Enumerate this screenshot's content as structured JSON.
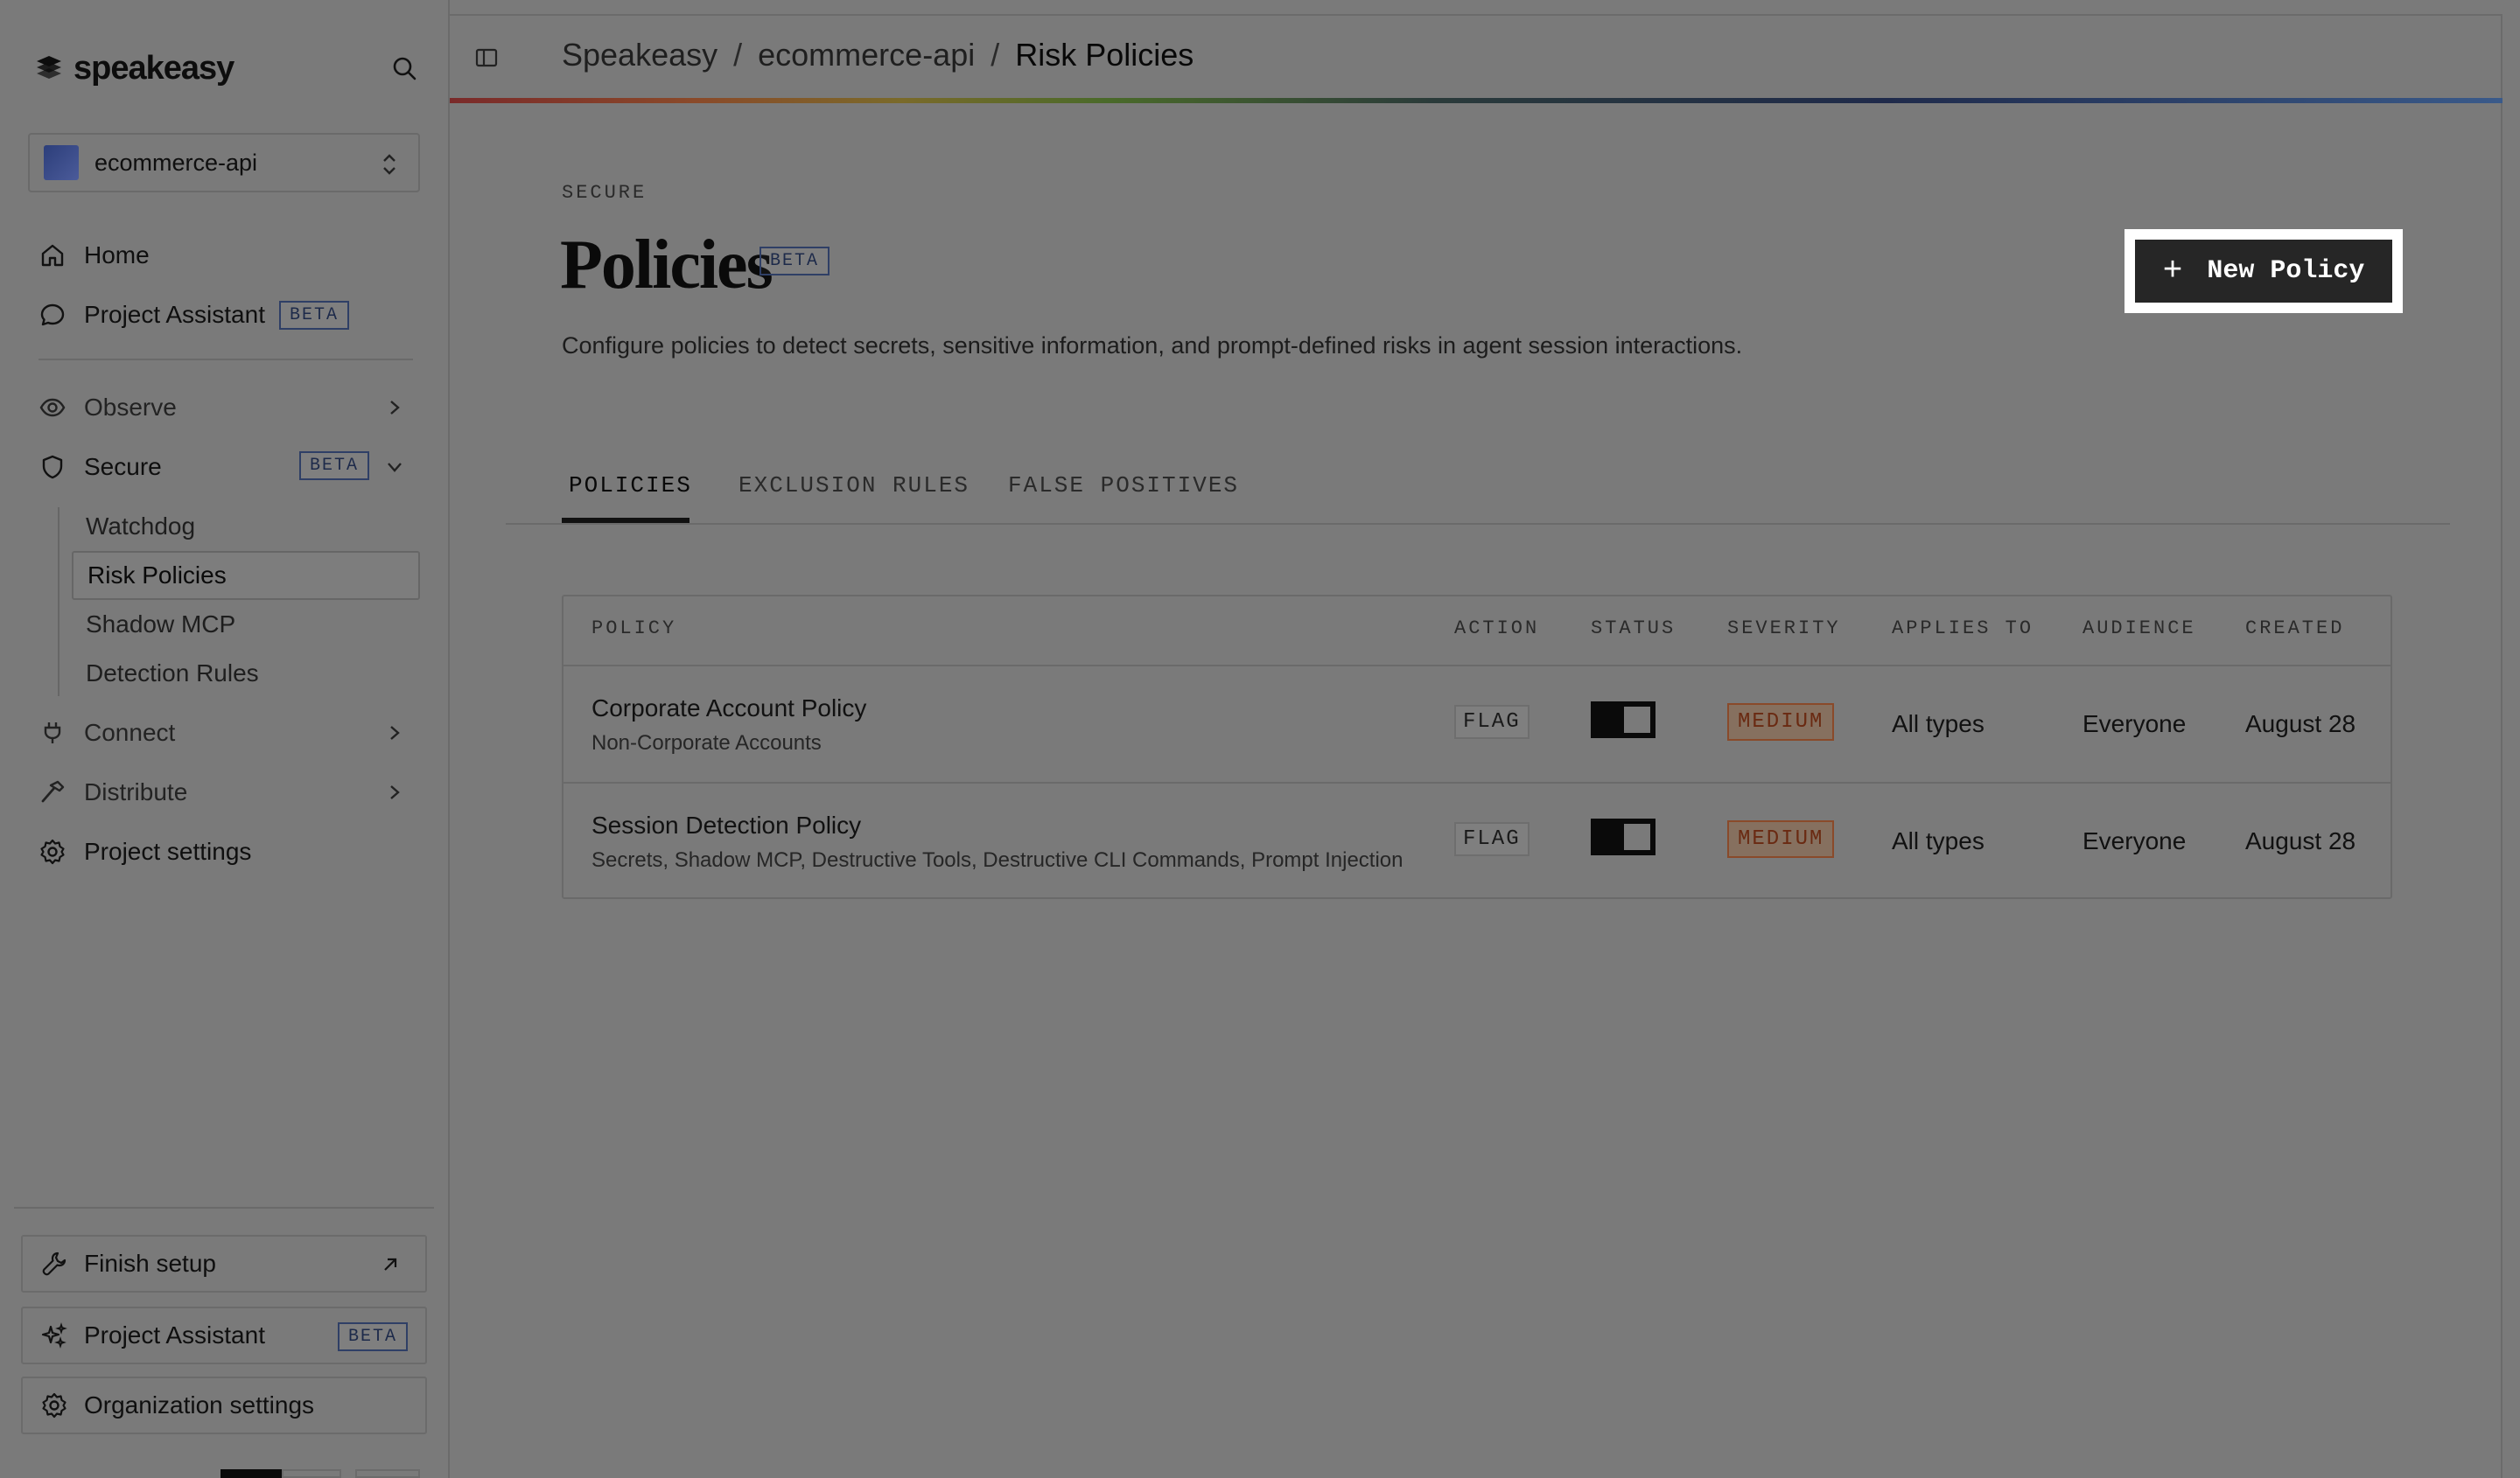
{
  "brand": {
    "name": "speakeasy"
  },
  "project": {
    "name": "ecommerce-api"
  },
  "sidebar": {
    "home": "Home",
    "assistant": {
      "label": "Project Assistant",
      "badge": "BETA"
    },
    "observe": "Observe",
    "secure": {
      "label": "Secure",
      "badge": "BETA"
    },
    "secure_items": [
      "Watchdog",
      "Risk Policies",
      "Shadow MCP",
      "Detection Rules"
    ],
    "connect": "Connect",
    "distribute": "Distribute",
    "project_settings": "Project settings",
    "footer": {
      "finish_setup": "Finish setup",
      "assistant": {
        "label": "Project Assistant",
        "badge": "BETA"
      },
      "org_settings": "Organization settings"
    }
  },
  "breadcrumb": [
    "Speakeasy",
    "ecommerce-api",
    "Risk Policies"
  ],
  "breadcrumb_sep": "/",
  "page": {
    "eyebrow": "SECURE",
    "title": "Policies",
    "title_badge": "BETA",
    "subtitle": "Configure policies to detect secrets, sensitive information, and prompt-defined risks in agent session interactions.",
    "new_button": "New Policy",
    "new_button_icon": "+"
  },
  "tabs": [
    "POLICIES",
    "EXCLUSION RULES",
    "FALSE POSITIVES"
  ],
  "active_tab": "POLICIES",
  "table": {
    "headers": [
      "POLICY",
      "ACTION",
      "STATUS",
      "SEVERITY",
      "APPLIES TO",
      "AUDIENCE",
      "CREATED"
    ],
    "rows": [
      {
        "name": "Corporate Account Policy",
        "detail": "Non-Corporate Accounts",
        "action": "FLAG",
        "enabled": true,
        "severity": "MEDIUM",
        "applies_to": "All types",
        "audience": "Everyone",
        "created": "August 28"
      },
      {
        "name": "Session Detection Policy",
        "detail": "Secrets, Shadow MCP, Destructive Tools, Destructive CLI Commands, Prompt Injection",
        "action": "FLAG",
        "enabled": true,
        "severity": "MEDIUM",
        "applies_to": "All types",
        "audience": "Everyone",
        "created": "August 28"
      }
    ]
  },
  "colors": {
    "background": "#7a7a7a",
    "primary_button": "#262626",
    "severity_medium": "#6a2a12",
    "beta_badge": "#2f3f66"
  }
}
